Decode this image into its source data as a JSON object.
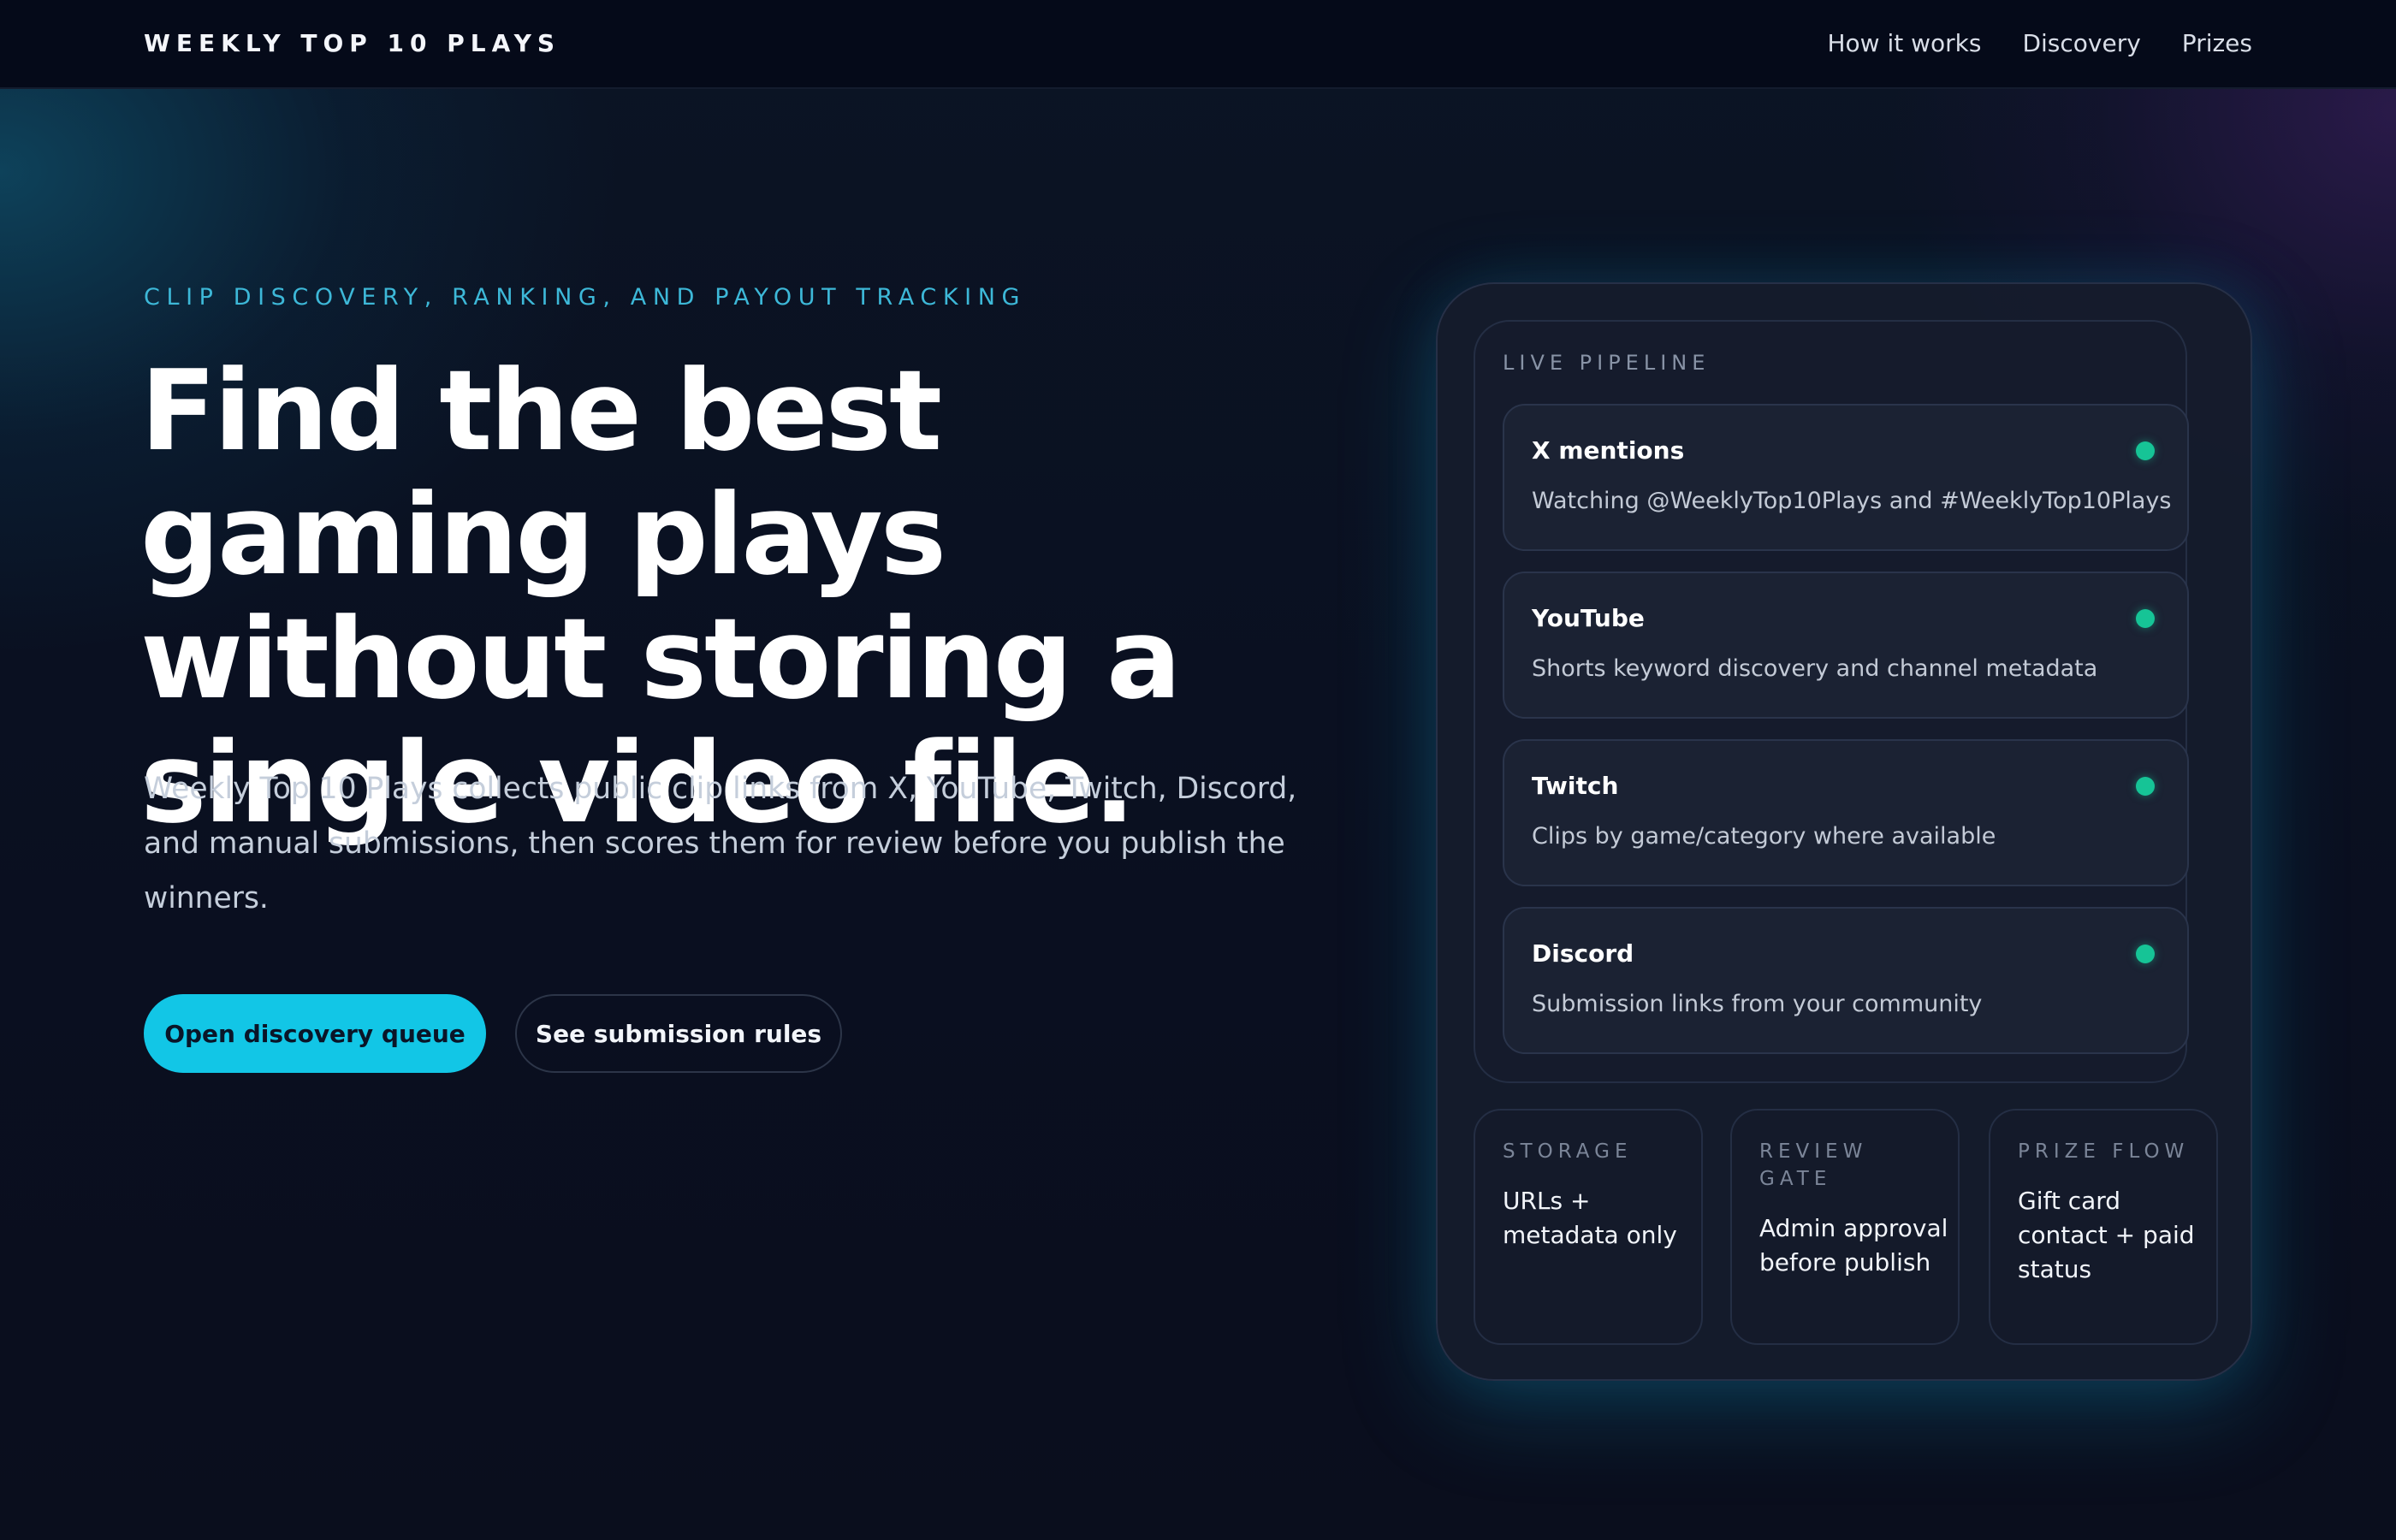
{
  "header": {
    "brand": "WEEKLY TOP 10 PLAYS",
    "nav": [
      {
        "label": "How it works"
      },
      {
        "label": "Discovery"
      },
      {
        "label": "Prizes"
      }
    ]
  },
  "hero": {
    "eyebrow": "CLIP DISCOVERY, RANKING, AND PAYOUT TRACKING",
    "headline": "Find the best gaming plays without storing a single video file.",
    "description": "Weekly Top 10 Plays collects public clip links from X, YouTube, Twitch, Discord, and manual submissions, then scores them for review before you publish the winners.",
    "primary_cta": "Open discovery queue",
    "secondary_cta": "See submission rules"
  },
  "pipeline": {
    "title": "LIVE PIPELINE",
    "sources": [
      {
        "name": "X mentions",
        "description": "Watching @WeeklyTop10Plays and #WeeklyTop10Plays",
        "status_color": "#16c496"
      },
      {
        "name": "YouTube",
        "description": "Shorts keyword discovery and channel metadata",
        "status_color": "#16c496"
      },
      {
        "name": "Twitch",
        "description": "Clips by game/category where available",
        "status_color": "#16c496"
      },
      {
        "name": "Discord",
        "description": "Submission links from your community",
        "status_color": "#16c496"
      }
    ]
  },
  "stats": [
    {
      "label": "STORAGE",
      "value": "URLs + metadata only"
    },
    {
      "label": "REVIEW GATE",
      "value": "Admin approval before publish"
    },
    {
      "label": "PRIZE FLOW",
      "value": "Gift card contact + paid status"
    }
  ],
  "colors": {
    "accent": "#12c6e6",
    "eyebrow": "#3db8d8",
    "status_active": "#16c496",
    "background": "#0a0f1f"
  }
}
